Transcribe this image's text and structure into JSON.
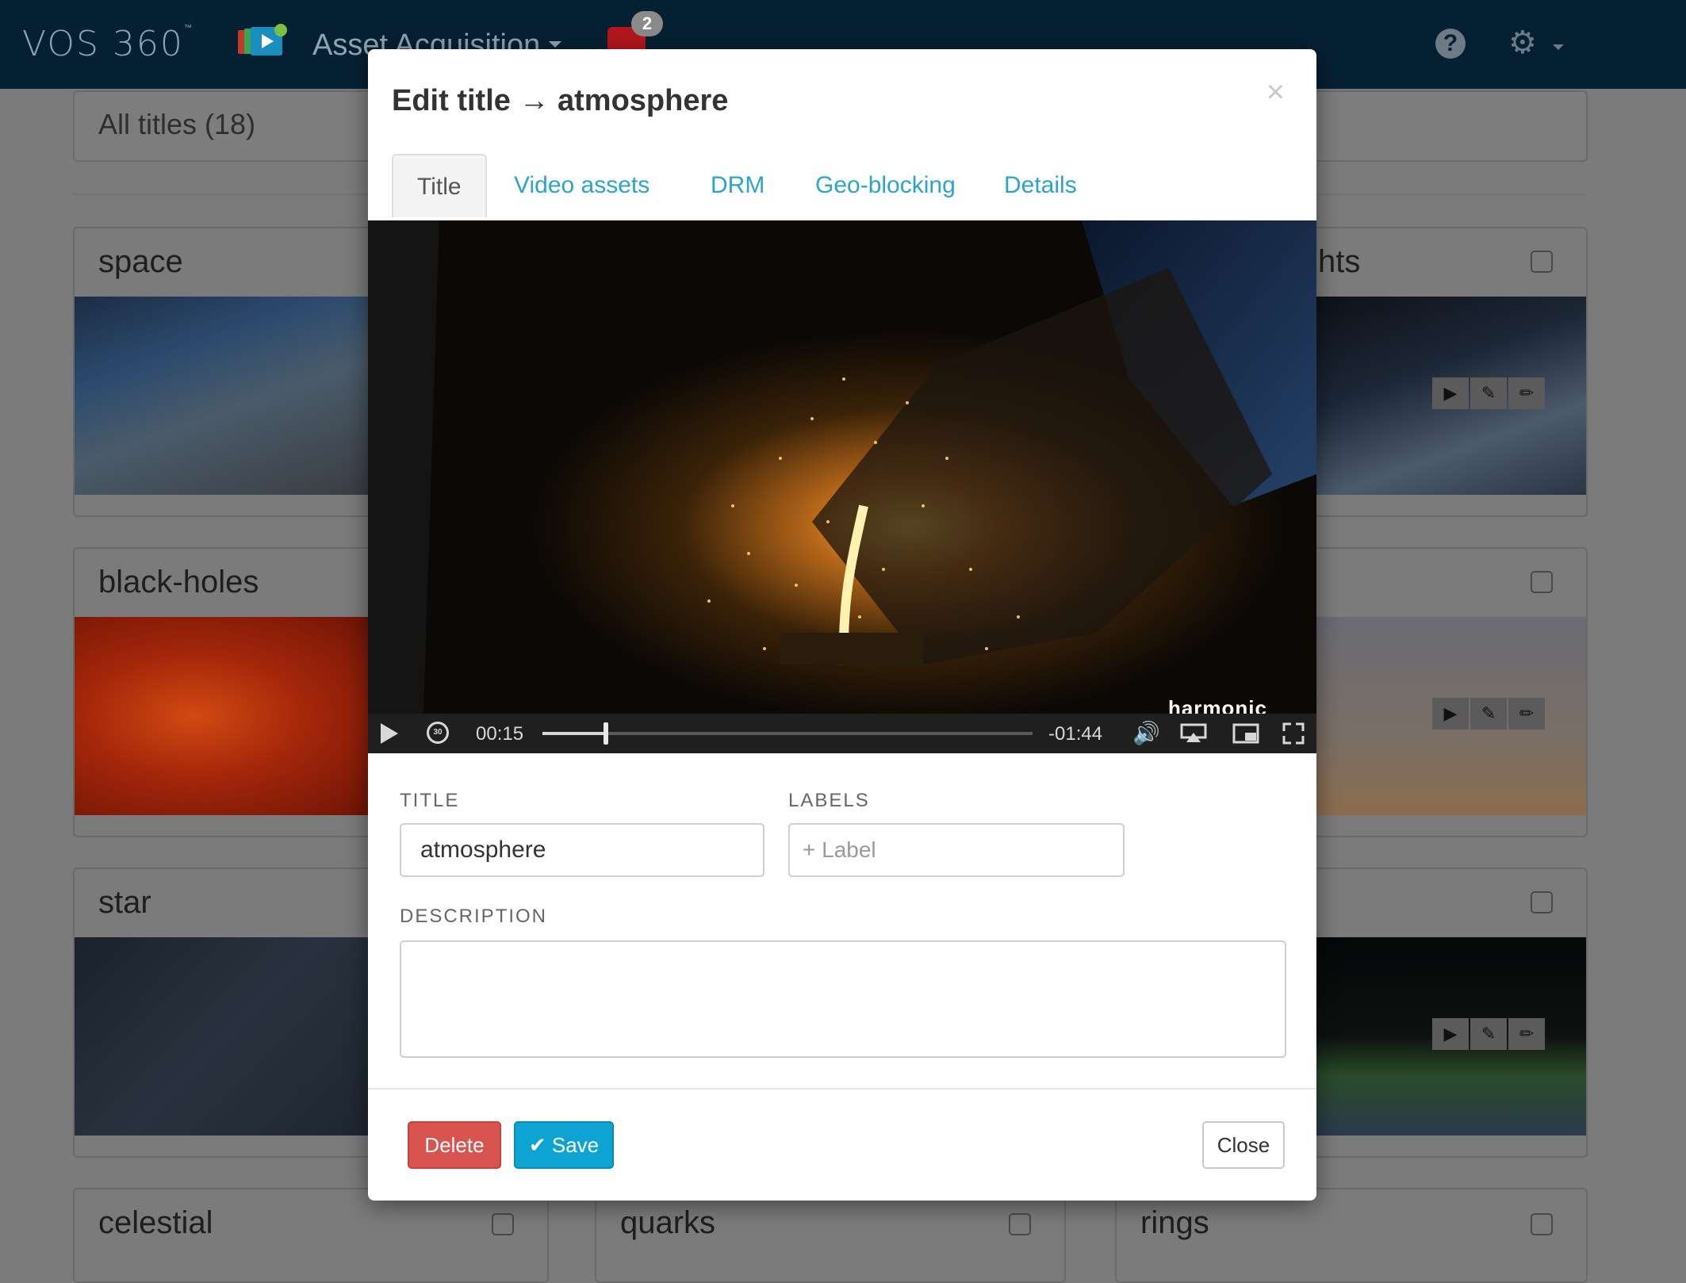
{
  "navbar": {
    "logo": "VOS 360",
    "logo_mark": "™",
    "app_name": "Asset Acquisition",
    "alert_count": "2"
  },
  "page": {
    "filter_label": "All titles (18)",
    "cards": [
      {
        "title": "space"
      },
      {
        "title": "black-holes"
      },
      {
        "title": "star"
      },
      {
        "title": "celestial"
      },
      {
        "title": "quarks"
      },
      {
        "title": "rings"
      },
      {
        "title": "hts"
      }
    ]
  },
  "modal": {
    "title": "Edit title → atmosphere",
    "close_symbol": "×",
    "tabs": [
      {
        "label": "Title",
        "active": true
      },
      {
        "label": "Video assets"
      },
      {
        "label": "DRM"
      },
      {
        "label": "Geo-blocking"
      },
      {
        "label": "Details"
      }
    ],
    "player": {
      "current_time": "00:15",
      "remaining_time": "-01:44",
      "progress": 0.13,
      "rewind_seconds": "30",
      "watermark": "harmonic"
    },
    "form": {
      "title_label": "TITLE",
      "title_value": "atmosphere",
      "labels_label": "LABELS",
      "labels_placeholder": "+ Label",
      "description_label": "DESCRIPTION",
      "description_value": ""
    },
    "buttons": {
      "delete": "Delete",
      "save": "Save",
      "close": "Close"
    }
  },
  "colors": {
    "navbar": "#062033",
    "accent": "#2ba5c7",
    "delete": "#d9534f",
    "save": "#0fa3d3"
  }
}
